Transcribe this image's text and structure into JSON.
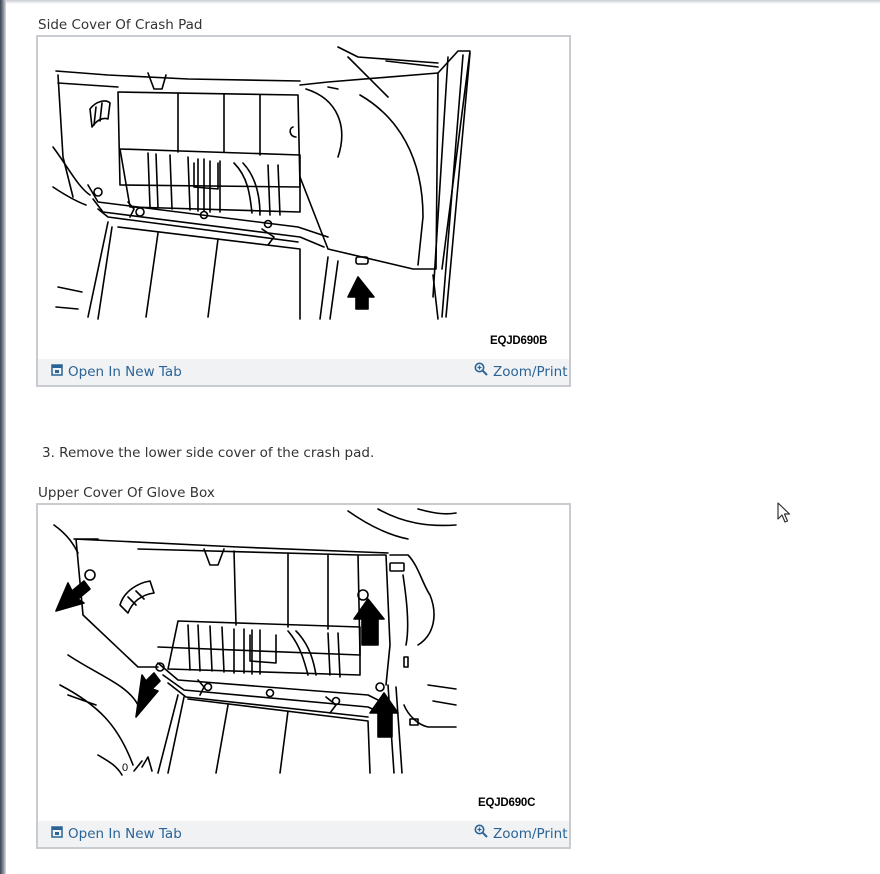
{
  "figures": [
    {
      "title": "Side Cover Of Crash Pad",
      "image_code": "EQJD690B",
      "open_label": "Open In New Tab",
      "zoom_label": "Zoom/Print",
      "open_icon": "open-in-new-tab-icon",
      "zoom_icon": "magnifier-zoom-icon"
    },
    {
      "title": "Upper Cover Of Glove Box",
      "image_code": "EQJD690C",
      "open_label": "Open In New Tab",
      "zoom_label": "Zoom/Print",
      "open_icon": "open-in-new-tab-icon",
      "zoom_icon": "magnifier-zoom-icon"
    }
  ],
  "step_text": "3. Remove the lower side cover of the crash pad.",
  "colors": {
    "link": "#2a6496",
    "toolbar_bg": "#f1f2f4",
    "frame_border": "#c8cbcf",
    "text": "#333333"
  }
}
